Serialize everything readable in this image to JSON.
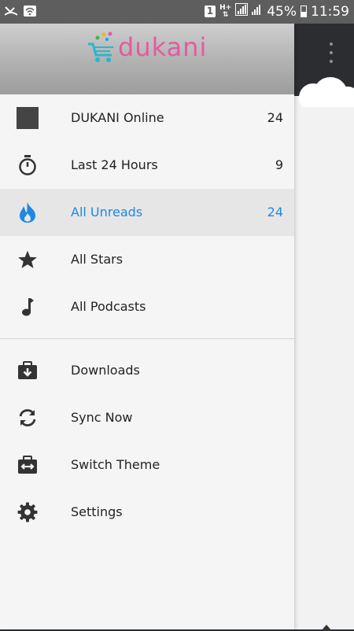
{
  "status_bar": {
    "sim": "1",
    "network": "H+",
    "battery": "45%",
    "time": "11:59"
  },
  "drawer": {
    "logo_text": "dukani",
    "feeds": [
      {
        "label": "DUKANI Online",
        "count": "24",
        "icon": "feed-square-icon",
        "active": false
      },
      {
        "label": "Last 24 Hours",
        "count": "9",
        "icon": "stopwatch-icon",
        "active": false
      },
      {
        "label": "All Unreads",
        "count": "24",
        "icon": "fire-icon",
        "active": true
      },
      {
        "label": "All Stars",
        "count": "",
        "icon": "star-icon",
        "active": false
      },
      {
        "label": "All Podcasts",
        "count": "",
        "icon": "music-note-icon",
        "active": false
      }
    ],
    "actions": [
      {
        "label": "Downloads",
        "icon": "download-box-icon"
      },
      {
        "label": "Sync Now",
        "icon": "sync-icon"
      },
      {
        "label": "Switch Theme",
        "icon": "switch-theme-icon"
      },
      {
        "label": "Settings",
        "icon": "gear-icon"
      }
    ]
  },
  "colors": {
    "accent": "#1e88e5",
    "toolbar": "#2b2d31",
    "drawer_bg": "#f5f5f5",
    "active_bg": "#e6e6e6"
  }
}
